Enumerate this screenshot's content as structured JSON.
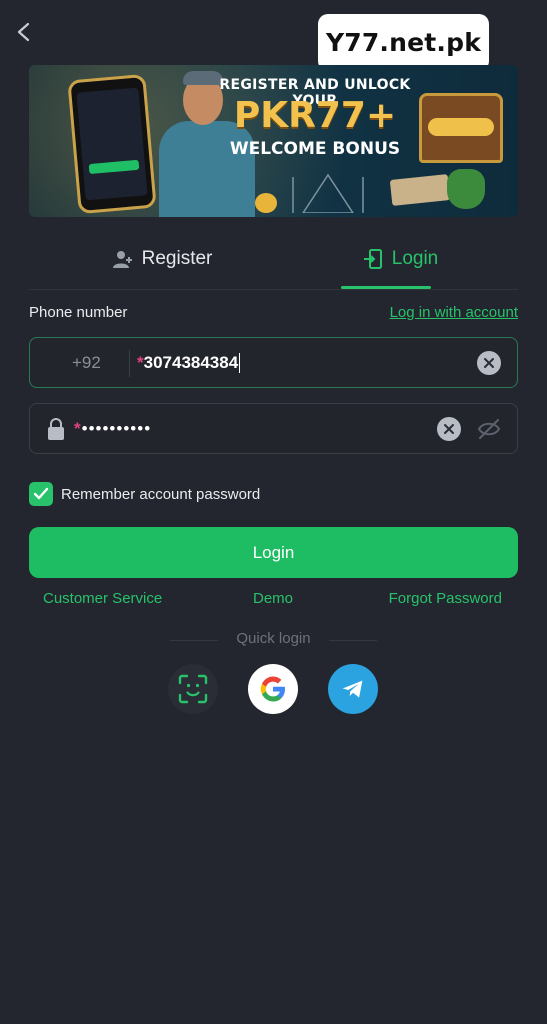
{
  "header": {
    "brand": "Y77.net.pk",
    "back_icon": "chevron-left-icon"
  },
  "banner": {
    "line1": "REGISTER AND UNLOCK YOUR",
    "line2": "PKR77+",
    "line3": "WELCOME BONUS"
  },
  "tabs": [
    {
      "label": "Register",
      "icon": "user-plus-icon",
      "active": false
    },
    {
      "label": "Login",
      "icon": "login-door-icon",
      "active": true
    }
  ],
  "form": {
    "phone_label": "Phone number",
    "login_with_account": "Log in with account",
    "country_code": "+92",
    "required_mark": "*",
    "phone_value": "3074384384",
    "password_mask": "••••••••••",
    "remember_label": "Remember account password",
    "remember_checked": true
  },
  "actions": {
    "login_label": "Login",
    "customer_service": "Customer Service",
    "demo": "Demo",
    "forgot_password": "Forgot Password"
  },
  "quick_login": {
    "title": "Quick login",
    "options": [
      "face-id-icon",
      "google-icon",
      "telegram-icon"
    ]
  },
  "colors": {
    "background": "#23262e",
    "accent": "#27c26a",
    "button": "#1fbd63",
    "required": "#e0457b"
  }
}
